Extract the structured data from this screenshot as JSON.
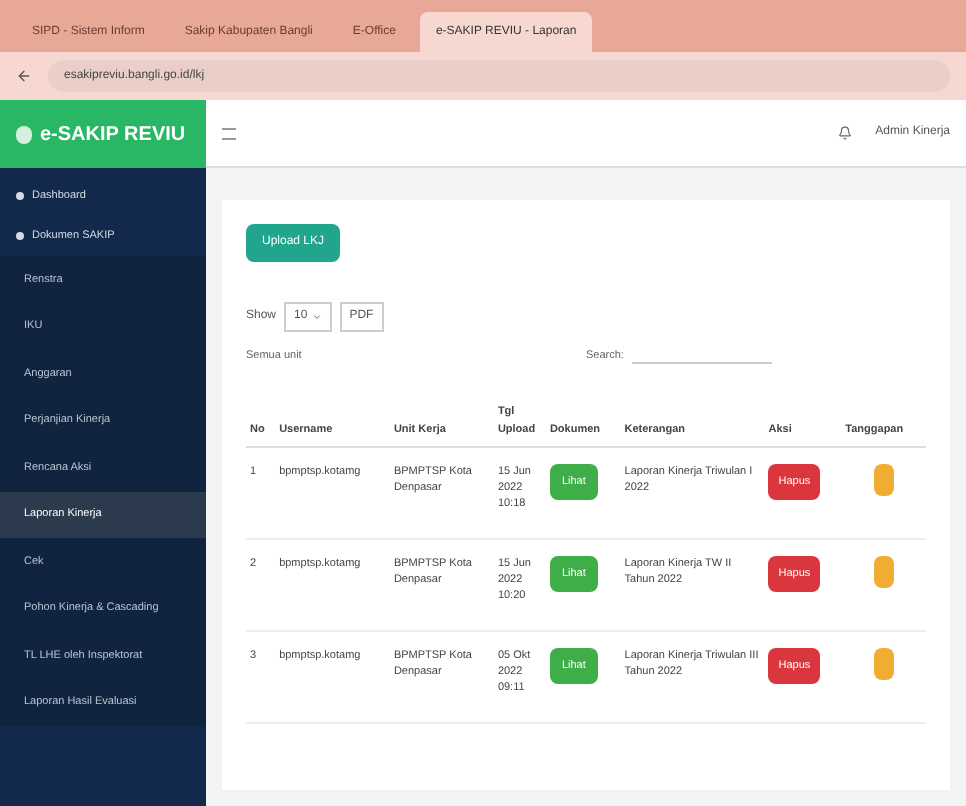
{
  "browser": {
    "tabs": [
      {
        "label": "SIPD - Sistem Inform",
        "selected": false
      },
      {
        "label": "Sakip Kabupaten Bangli",
        "selected": false
      },
      {
        "label": "E-Office",
        "selected": false
      },
      {
        "label": "e-SAKIP REVIU - Laporan",
        "selected": true
      }
    ],
    "url": "esakipreviu.bangli.go.id/lkj"
  },
  "app": {
    "logo": "e-SAKIP REVIU",
    "user": "Admin Kinerja"
  },
  "sidebar": {
    "items": [
      {
        "label": "Dashboard",
        "selected": false
      },
      {
        "label": "Dokumen SAKIP",
        "selected": false,
        "children": [
          {
            "label": "Renstra",
            "selected": false
          },
          {
            "label": "IKU",
            "selected": false
          },
          {
            "label": "Anggaran",
            "selected": false
          },
          {
            "label": "Perjanjian Kinerja",
            "selected": false
          },
          {
            "label": "Rencana Aksi",
            "selected": false
          },
          {
            "label": "Laporan Kinerja",
            "selected": true
          },
          {
            "label": "Cek",
            "selected": false
          },
          {
            "label": "Pohon Kinerja & Cascading",
            "selected": false
          },
          {
            "label": "TL LHE oleh Inspektorat",
            "selected": false
          },
          {
            "label": "Laporan Hasil Evaluasi",
            "selected": false
          }
        ]
      }
    ]
  },
  "content": {
    "upload_button": "Upload LKJ",
    "show_label": "Show",
    "page_size": "10",
    "export_button": "PDF",
    "filter_text": "Semua unit",
    "search_label": "Search:",
    "table": {
      "columns": [
        "No",
        "Username",
        "Unit Kerja",
        "Tgl Upload",
        "Dokumen",
        "Keterangan",
        "Aksi",
        "Tanggapan"
      ],
      "rows": [
        {
          "no": "1",
          "username": "bpmptsp.kotamg",
          "unit": "BPMPTSP Kota Denpasar",
          "date": "15 Jun 2022 10:18",
          "doc": "Lihat",
          "note": "Laporan Kinerja Triwulan I 2022",
          "action": "Hapus"
        },
        {
          "no": "2",
          "username": "bpmptsp.kotamg",
          "unit": "BPMPTSP Kota Denpasar",
          "date": "15 Jun 2022 10:20",
          "doc": "Lihat",
          "note": "Laporan Kinerja TW II Tahun 2022",
          "action": "Hapus"
        },
        {
          "no": "3",
          "username": "bpmptsp.kotamg",
          "unit": "BPMPTSP Kota Denpasar",
          "date": "05 Okt 2022 09:11",
          "doc": "Lihat",
          "note": "Laporan Kinerja Triwulan III Tahun 2022",
          "action": "Hapus"
        }
      ]
    }
  }
}
